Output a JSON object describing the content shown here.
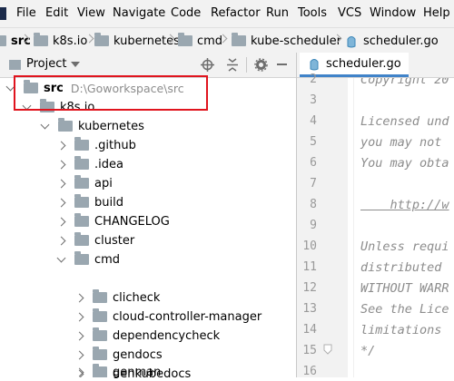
{
  "menu": [
    "File",
    "Edit",
    "View",
    "Navigate",
    "Code",
    "Refactor",
    "Run",
    "Tools",
    "VCS",
    "Window",
    "Help"
  ],
  "breadcrumb": [
    "src",
    "k8s.io",
    "kubernetes",
    "cmd",
    "kube-scheduler",
    "scheduler.go"
  ],
  "panel": {
    "title": "Project"
  },
  "tree": [
    {
      "label": "src",
      "path": "D:\\Goworkspace\\src"
    },
    {
      "label": "k8s.io"
    },
    {
      "label": "kubernetes"
    },
    {
      "label": ".github"
    },
    {
      "label": ".idea"
    },
    {
      "label": "api"
    },
    {
      "label": "build"
    },
    {
      "label": "CHANGELOG"
    },
    {
      "label": "cluster"
    },
    {
      "label": "cmd"
    },
    {
      "label": "clicheck"
    },
    {
      "label": "cloud-controller-manager"
    },
    {
      "label": "dependencycheck"
    },
    {
      "label": "gendocs"
    },
    {
      "label": "genkubedocs"
    },
    {
      "label": "genman"
    }
  ],
  "editor": {
    "tab": "scheduler.go",
    "line_numbers": [
      "2",
      "3",
      "4",
      "5",
      "6",
      "7",
      "8",
      "9",
      "10",
      "11",
      "12",
      "13",
      "14",
      "15",
      "16"
    ],
    "lines": [
      "Copyright 20",
      "",
      "Licensed und",
      "you may not",
      "You may obta",
      "",
      "    http://w",
      "",
      "Unless requi",
      "distributed",
      "WITHOUT WARR",
      "See the Lice",
      "limitations",
      "*/",
      ""
    ]
  }
}
